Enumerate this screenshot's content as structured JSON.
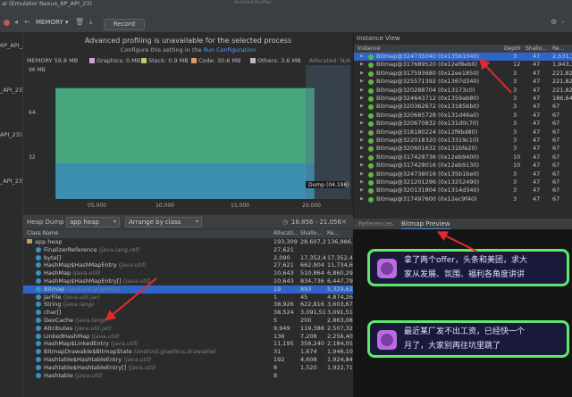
{
  "window": {
    "title": "al (Emulator Nexus_6P_API_23)",
    "center_title": "Android Profiler"
  },
  "toolbar": {
    "memory_label": "MEMORY",
    "record_label": "Record",
    "api_labels": [
      "6P_API_...",
      "_API_23)",
      "API_23)",
      "_API_23)"
    ]
  },
  "profiler": {
    "adv_title": "Advanced profiling is unavailable for the selected process",
    "adv_sub_prefix": "Configure this setting in the ",
    "adv_sub_link": "Run Configuration",
    "legend": {
      "memory": "MEMORY 59.8 MB",
      "graphics": "Graphics: 0 MB",
      "stack": "Stack: 0.9 MB",
      "code": "Code: 30.6 MB",
      "others": "Others: 3.6 MB",
      "allocated": "Allocated: N/A"
    },
    "dump_label": "Dump (04.196)"
  },
  "chart_data": {
    "type": "area",
    "title": "",
    "xlabel": "",
    "ylabel": "",
    "x_ticks": [
      "05.000",
      "10.000",
      "15.000",
      "20.000"
    ],
    "y_ticks": [
      "96 MB",
      "64",
      "32"
    ],
    "ylim": [
      0,
      105
    ],
    "xlim": [
      0,
      22.5
    ],
    "series": [
      {
        "name": "Code",
        "color": "#48a67e",
        "values": [
          59,
          59,
          59,
          59,
          59
        ]
      },
      {
        "name": "Stack",
        "color": "#3d8fb0",
        "values": [
          28,
          28,
          28,
          28,
          28
        ]
      }
    ],
    "x": [
      2,
      8,
      14,
      18,
      20
    ]
  },
  "heap": {
    "label": "Heap Dump",
    "heap_select": "app heap",
    "arrange_select": "Arrange by class",
    "range": "16.856 - 21.056",
    "columns": [
      "Class Name",
      "Allocati...",
      "Shallo...",
      "Re..."
    ],
    "rows": [
      {
        "name": "app heap",
        "pkg": "",
        "a": "193,309",
        "s": "28,607,2",
        "r": "136,986,1",
        "type": "folder"
      },
      {
        "name": "FinalizerReference",
        "pkg": "(java.lang.ref)",
        "a": "27,621",
        "s": "",
        "r": "",
        "type": "class"
      },
      {
        "name": "byte[]",
        "pkg": "",
        "a": "2,090",
        "s": "17,352,4",
        "r": "17,352,4",
        "type": "class"
      },
      {
        "name": "HashMap$HashMapEntry",
        "pkg": "(java.util)",
        "a": "27,621",
        "s": "662,904",
        "r": "11,734,6",
        "type": "class"
      },
      {
        "name": "HashMap",
        "pkg": "(java.util)",
        "a": "10,643",
        "s": "510,864",
        "r": "6,860,29",
        "type": "class"
      },
      {
        "name": "HashMap$HashMapEntry[]",
        "pkg": "(java.util)",
        "a": "10,643",
        "s": "834,736",
        "r": "6,447,79",
        "type": "class"
      },
      {
        "name": "Bitmap",
        "pkg": "(android.graphics)",
        "a": "19",
        "s": "893",
        "r": "5,329,61",
        "type": "class",
        "selected": true
      },
      {
        "name": "JarFile",
        "pkg": "(java.util.jar)",
        "a": "1",
        "s": "45",
        "r": "4,874,26",
        "type": "class"
      },
      {
        "name": "String",
        "pkg": "(java.lang)",
        "a": "38,926",
        "s": "622,816",
        "r": "3,603,67",
        "type": "class"
      },
      {
        "name": "char[]",
        "pkg": "",
        "a": "38,524",
        "s": "3,091,51",
        "r": "3,091,51",
        "type": "class"
      },
      {
        "name": "DexCache",
        "pkg": "(java.lang)",
        "a": "5",
        "s": "200",
        "r": "2,863,08",
        "type": "class"
      },
      {
        "name": "Attributes",
        "pkg": "(java.util.jar)",
        "a": "9,949",
        "s": "119,388",
        "r": "2,507,32",
        "type": "class"
      },
      {
        "name": "LinkedHashMap",
        "pkg": "(java.util)",
        "a": "136",
        "s": "7,208",
        "r": "2,256,40",
        "type": "class"
      },
      {
        "name": "HashMap$LinkedEntry",
        "pkg": "(java.util)",
        "a": "11,195",
        "s": "358,240",
        "r": "2,184,05",
        "type": "class"
      },
      {
        "name": "BitmapDrawable$BitmapState",
        "pkg": "(android.graphics.drawable)",
        "a": "31",
        "s": "1,674",
        "r": "1,946,10",
        "type": "class"
      },
      {
        "name": "Hashtable$HashtableEntry",
        "pkg": "(java.util)",
        "a": "192",
        "s": "4,608",
        "r": "1,924,84",
        "type": "class"
      },
      {
        "name": "Hashtable$HashtableEntry[]",
        "pkg": "(java.util)",
        "a": "8",
        "s": "1,520",
        "r": "1,922,71",
        "type": "class"
      },
      {
        "name": "Hashtable",
        "pkg": "(java.util)",
        "a": "8",
        "s": "",
        "r": "",
        "type": "class"
      }
    ]
  },
  "instance_view": {
    "title": "Instance View",
    "columns": [
      "Instance",
      "Depth",
      "Shallo...",
      "Re..."
    ],
    "rows": [
      {
        "name": "Bitmap@324735040 (0x135b1040)",
        "d": "3",
        "s": "47",
        "r": "2,531,31",
        "selected": true
      },
      {
        "name": "Bitmap@317689520 (0x12ef8eb0)",
        "d": "12",
        "s": "47",
        "r": "1,943,30"
      },
      {
        "name": "Bitmap@317593680 (0x12ee1850)",
        "d": "3",
        "s": "47",
        "r": "221,827"
      },
      {
        "name": "Bitmap@325571392 (0x1367d340)",
        "d": "3",
        "s": "47",
        "r": "221,827"
      },
      {
        "name": "Bitmap@320288704 (0x13173c0)",
        "d": "3",
        "s": "47",
        "r": "221,827"
      },
      {
        "name": "Bitmap@324643712 (0x1359ab80)",
        "d": "3",
        "s": "47",
        "r": "186,647"
      },
      {
        "name": "Bitmap@320362672 (0x13185bb0)",
        "d": "3",
        "s": "47",
        "r": "67"
      },
      {
        "name": "Bitmap@320685728 (0x131d46a0)",
        "d": "3",
        "s": "47",
        "r": "67"
      },
      {
        "name": "Bitmap@320670832 (0x131d0c70)",
        "d": "3",
        "s": "47",
        "r": "67"
      },
      {
        "name": "Bitmap@318180224 (0x12f6bd80)",
        "d": "3",
        "s": "47",
        "r": "67"
      },
      {
        "name": "Bitmap@322018320 (0x13319c10)",
        "d": "3",
        "s": "47",
        "r": "67"
      },
      {
        "name": "Bitmap@320601632 (0x131bfe20)",
        "d": "3",
        "s": "47",
        "r": "67"
      },
      {
        "name": "Bitmap@317428736 (0x12eb9400)",
        "d": "10",
        "s": "47",
        "r": "67"
      },
      {
        "name": "Bitmap@317428016 (0x12eb9130)",
        "d": "10",
        "s": "47",
        "r": "67"
      },
      {
        "name": "Bitmap@324738016 (0x135b1be0)",
        "d": "3",
        "s": "47",
        "r": "67"
      },
      {
        "name": "Bitmap@321201296 (0x13252490)",
        "d": "3",
        "s": "47",
        "r": "67"
      },
      {
        "name": "Bitmap@320131804 (0x1314d340)",
        "d": "3",
        "s": "47",
        "r": "67"
      },
      {
        "name": "Bitmap@317497600 (0x12ec9f40)",
        "d": "3",
        "s": "47",
        "r": "67"
      }
    ]
  },
  "bottom_tabs": {
    "references": "References",
    "preview": "Bitmap Preview"
  },
  "bitmap_preview": {
    "bubble1_line1": "拿了两个offer，头条和美团，求大",
    "bubble1_line2": "家从发展、氛围、福利各角度讲讲",
    "bubble2_line1": "最近某厂发不出工资，已经快一个",
    "bubble2_line2": "月了，大家别再往坑里跳了"
  }
}
